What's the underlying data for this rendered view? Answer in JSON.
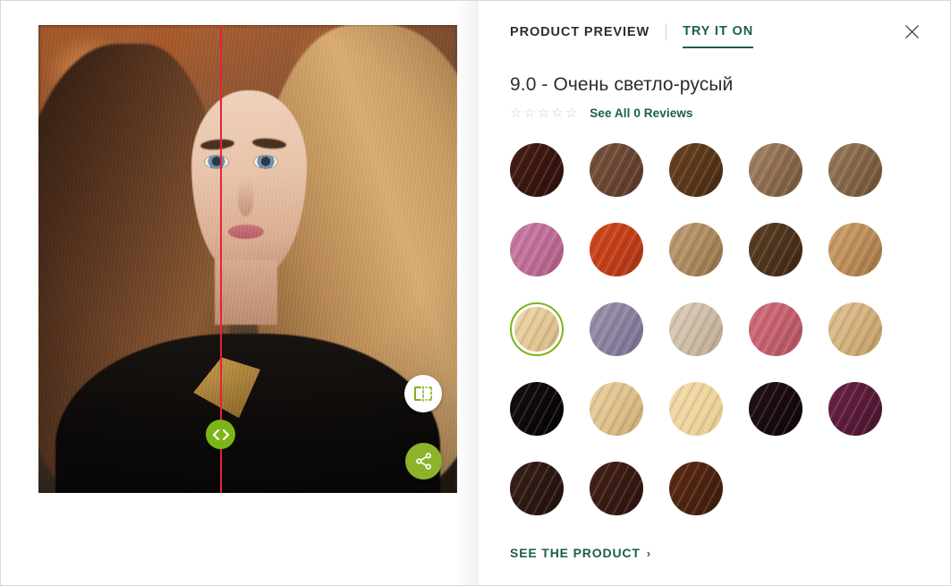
{
  "theme": {
    "accent_green": "#1b5e4b",
    "swatch_ring": "#7cb518",
    "share_button": "#8db32c",
    "split_line": "#e8203c"
  },
  "header": {
    "tab_preview": "PRODUCT PREVIEW",
    "tab_tryiton": "TRY IT ON",
    "close_icon": "close-icon"
  },
  "product": {
    "title": "9.0 - Очень светло-русый",
    "stars": [
      "☆",
      "☆",
      "☆",
      "☆",
      "☆"
    ],
    "reviews_label": "See All 0 Reviews",
    "see_product_label": "SEE THE PRODUCT",
    "see_product_chevron": "›"
  },
  "preview": {
    "compare_icon": "split-compare-icon",
    "share_icon": "share-icon",
    "slider_icon": "left-right-arrows-icon"
  },
  "swatches": [
    {
      "name": "swatch-1",
      "top": "#4a1f15",
      "mid": "#3a1610",
      "bottom": "#2b100b"
    },
    {
      "name": "swatch-2",
      "top": "#7d5540",
      "mid": "#6a4632",
      "bottom": "#543426"
    },
    {
      "name": "swatch-3",
      "top": "#6b4322",
      "mid": "#5a3719",
      "bottom": "#432711"
    },
    {
      "name": "swatch-4",
      "top": "#a98a6b",
      "mid": "#8d6c4e",
      "bottom": "#6f5238"
    },
    {
      "name": "swatch-5",
      "top": "#9b7e5e",
      "mid": "#836546",
      "bottom": "#6a4d32"
    },
    {
      "name": "swatch-6",
      "top": "#cc7fa8",
      "mid": "#bf6f97",
      "bottom": "#a85a81"
    },
    {
      "name": "swatch-7",
      "top": "#d4491f",
      "mid": "#c23f19",
      "bottom": "#a63412"
    },
    {
      "name": "swatch-8",
      "top": "#c2a077",
      "mid": "#ad8a5f",
      "bottom": "#8f6c45"
    },
    {
      "name": "swatch-9",
      "top": "#5f4128",
      "mid": "#4e331d",
      "bottom": "#3c2514"
    },
    {
      "name": "swatch-10",
      "top": "#cfa471",
      "mid": "#bb8d58",
      "bottom": "#9a7040"
    },
    {
      "name": "swatch-11",
      "top": "#efd9b0",
      "mid": "#e3c895",
      "bottom": "#d2b47d",
      "selected": true
    },
    {
      "name": "swatch-12",
      "top": "#9e95ae",
      "mid": "#8b81a0",
      "bottom": "#766c8c"
    },
    {
      "name": "swatch-13",
      "top": "#ded0bd",
      "mid": "#cdbda6",
      "bottom": "#b8a68c"
    },
    {
      "name": "swatch-14",
      "top": "#d4717f",
      "mid": "#c4606f",
      "bottom": "#ad4f5e"
    },
    {
      "name": "swatch-15",
      "top": "#e2c395",
      "mid": "#d3b07c",
      "bottom": "#bd9762"
    },
    {
      "name": "swatch-16",
      "top": "#140e12",
      "mid": "#0c080b",
      "bottom": "#060405"
    },
    {
      "name": "swatch-17",
      "top": "#ecd3a4",
      "mid": "#ddc08a",
      "bottom": "#c7a86e"
    },
    {
      "name": "swatch-18",
      "top": "#f2dcab",
      "mid": "#eed59e",
      "bottom": "#e3c78c"
    },
    {
      "name": "swatch-19",
      "top": "#22121a",
      "mid": "#180b11",
      "bottom": "#0f0609"
    },
    {
      "name": "swatch-20",
      "top": "#6d2447",
      "mid": "#5a1b3a",
      "bottom": "#46132c"
    },
    {
      "name": "swatch-21",
      "top": "#3a221c",
      "mid": "#2d1813",
      "bottom": "#1f0f0c"
    },
    {
      "name": "swatch-22",
      "top": "#46231c",
      "mid": "#381a13",
      "bottom": "#2a120d"
    },
    {
      "name": "swatch-23",
      "top": "#5e2d16",
      "mid": "#4d2310",
      "bottom": "#3a1a0b"
    }
  ]
}
